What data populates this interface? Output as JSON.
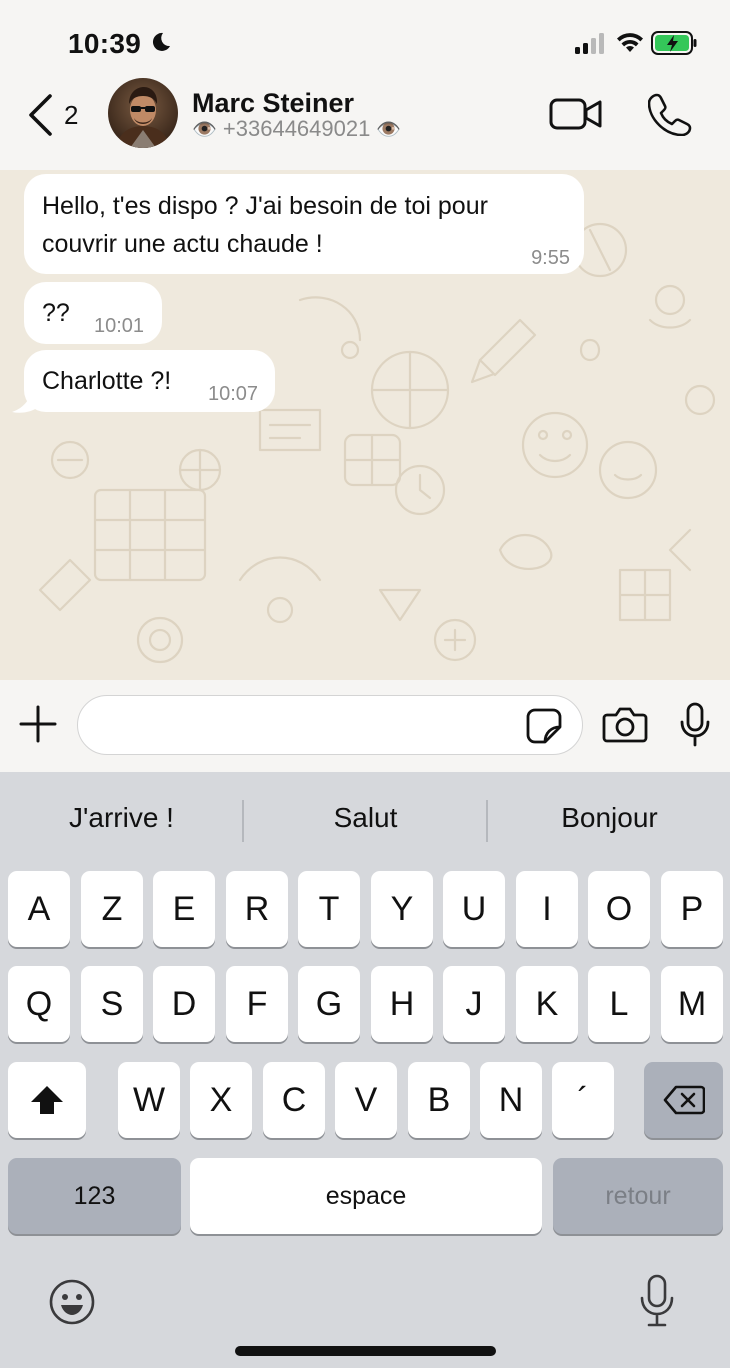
{
  "status_bar": {
    "time": "10:39",
    "icons": [
      "moon-icon",
      "signal-icon",
      "wifi-icon",
      "battery-charging-icon"
    ]
  },
  "header": {
    "back_count": "2",
    "contact_name": "Marc Steiner",
    "contact_phone": "+33644649021",
    "eye_left": "👁️",
    "eye_right": "👁️",
    "icons": [
      "chevron-left-icon",
      "video-call-icon",
      "phone-call-icon"
    ]
  },
  "messages": [
    {
      "text": "Hello, t'es dispo ? J'ai besoin de toi pour couvrir une actu chaude !",
      "time": "9:55"
    },
    {
      "text": "??",
      "time": "10:01"
    },
    {
      "text": "Charlotte ?!",
      "time": "10:07"
    }
  ],
  "input_bar": {
    "placeholder": "",
    "icons": [
      "plus-icon",
      "sticker-icon",
      "camera-icon",
      "microphone-icon"
    ]
  },
  "keyboard": {
    "suggestions": [
      "J'arrive !",
      "Salut",
      "Bonjour"
    ],
    "row1": [
      "A",
      "Z",
      "E",
      "R",
      "T",
      "Y",
      "U",
      "I",
      "O",
      "P"
    ],
    "row2": [
      "Q",
      "S",
      "D",
      "F",
      "G",
      "H",
      "J",
      "K",
      "L",
      "M"
    ],
    "row3": [
      "W",
      "X",
      "C",
      "V",
      "B",
      "N",
      "´"
    ],
    "numbers_label": "123",
    "space_label": "espace",
    "return_label": "retour"
  },
  "colors": {
    "chat_background": "#efe9dd",
    "bubble": "#ffffff",
    "keyboard": "#d6d8dc",
    "battery_green": "#34c759"
  }
}
